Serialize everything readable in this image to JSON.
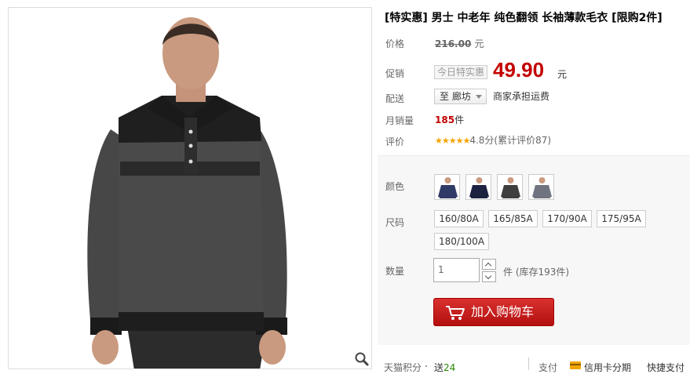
{
  "product": {
    "title": "[特实惠] 男士 中老年 纯色翻领 长袖薄款毛衣 [限购2件]"
  },
  "price": {
    "label": "价格",
    "original": "216.00",
    "unit": "元"
  },
  "promo": {
    "label": "促销",
    "tag": "今日特实惠",
    "price": "49.90",
    "unit": "元"
  },
  "shipping": {
    "label": "配送",
    "destination": "至 廊坊",
    "note": "商家承担运费"
  },
  "sales": {
    "label": "月销量",
    "count": "185",
    "unit": "件"
  },
  "rating": {
    "label": "评价",
    "stars": "★★★★★",
    "score_text": "4.8分(累计评价87)",
    "score": 4.8
  },
  "color": {
    "label": "颜色",
    "swatches": [
      "navy-sweater",
      "dark-navy-sweater",
      "charcoal-sweater",
      "gray-sweater"
    ]
  },
  "size": {
    "label": "尺码",
    "options": [
      "160/80A",
      "165/85A",
      "170/90A",
      "175/95A",
      "180/100A"
    ]
  },
  "quantity": {
    "label": "数量",
    "value": "1",
    "unit": "件",
    "stock": "(库存193件)"
  },
  "cart": {
    "label": "加入购物车"
  },
  "footer": {
    "points_label": "天猫积分",
    "points_value_prefix": "送",
    "points_value": "24",
    "pay_label": "支付",
    "credit_label": "信用卡分期",
    "quick_label": "快捷支付"
  },
  "colors": {
    "accent": "#c40000",
    "cart_button": "#c41a1a",
    "star": "#f7a400",
    "points": "#2a8a00"
  },
  "icons": [
    "zoom-icon",
    "cart-icon",
    "chevron-down-icon",
    "credit-card-icon",
    "stepper-up-icon",
    "stepper-down-icon"
  ]
}
